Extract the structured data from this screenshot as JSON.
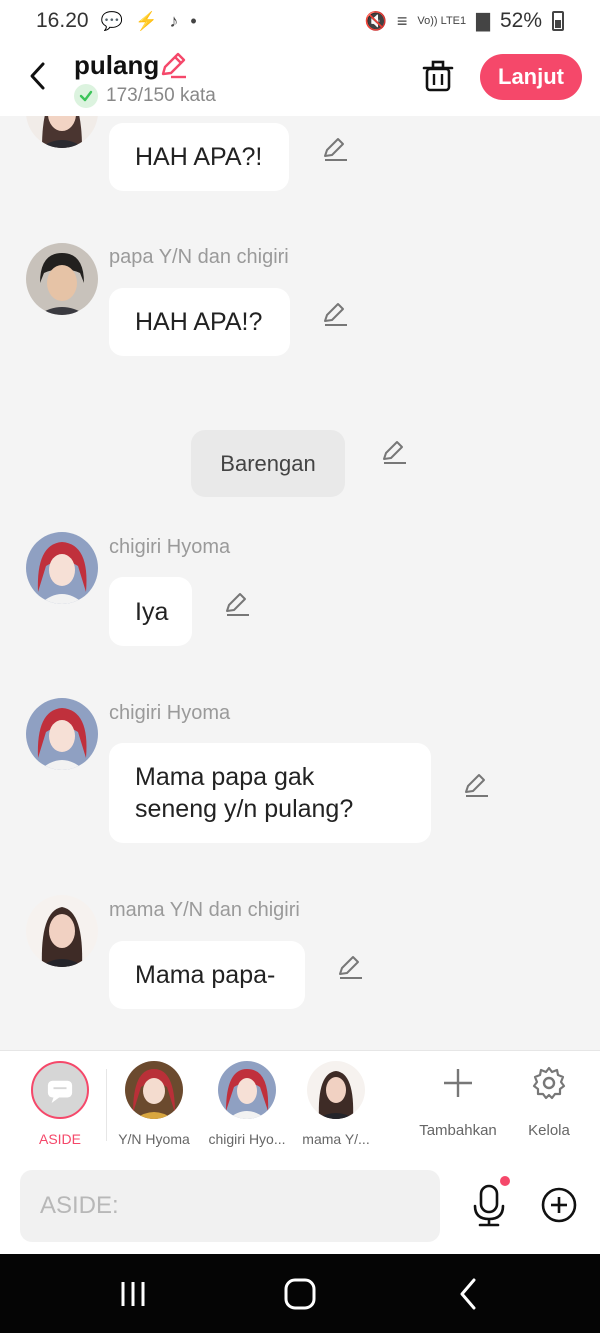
{
  "status_bar": {
    "time": "16.20",
    "battery": "52%",
    "network": "Vo)) LTE1"
  },
  "header": {
    "title": "pulang",
    "word_count": "173/150 kata",
    "next_label": "Lanjut"
  },
  "colors": {
    "accent": "#f5486a",
    "background": "#f4f4f4",
    "bubble": "#ffffff",
    "check": "#3cc45a"
  },
  "messages": [
    {
      "sender": "",
      "text": "HAH APA?!"
    },
    {
      "sender": "papa Y/N dan chigiri",
      "text": "HAH APA!?"
    },
    {
      "sender": "",
      "text": "Barengan",
      "type": "aside"
    },
    {
      "sender": "chigiri Hyoma",
      "text": "Iya"
    },
    {
      "sender": "chigiri Hyoma",
      "text_lines": [
        "Mama papa gak",
        "seneng y/n pulang?"
      ]
    },
    {
      "sender": "mama Y/N dan chigiri",
      "text": "Mama papa-"
    }
  ],
  "characters": [
    {
      "label": "ASIDE",
      "icon": "chat-bubble-icon",
      "selected": true
    },
    {
      "label": "Y/N Hyoma"
    },
    {
      "label": "chigiri Hyo..."
    },
    {
      "label": "mama Y/..."
    }
  ],
  "tools": {
    "add_label": "Tambahkan",
    "manage_label": "Kelola"
  },
  "input": {
    "placeholder": "ASIDE:"
  }
}
